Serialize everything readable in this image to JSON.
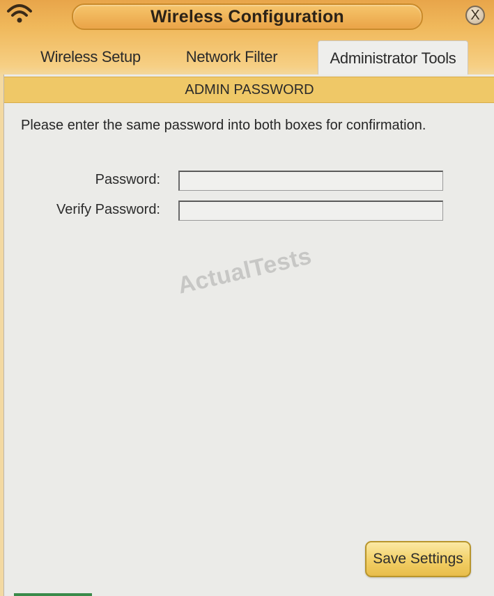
{
  "window": {
    "title": "Wireless Configuration",
    "close_label": "X",
    "accent_color": "#efc867",
    "wifi_icon": "wifi-icon"
  },
  "tabs": [
    {
      "label": "Wireless Setup",
      "active": false
    },
    {
      "label": "Network Filter",
      "active": false
    },
    {
      "label": "Administrator Tools",
      "active": true
    }
  ],
  "section": {
    "title": "ADMIN PASSWORD",
    "instructions": "Please enter the same password into both boxes for confirmation."
  },
  "form": {
    "password_label": "Password:",
    "password_value": "",
    "verify_label": "Verify Password:",
    "verify_value": ""
  },
  "watermark": "ActualTests",
  "actions": {
    "save_label": "Save Settings"
  }
}
